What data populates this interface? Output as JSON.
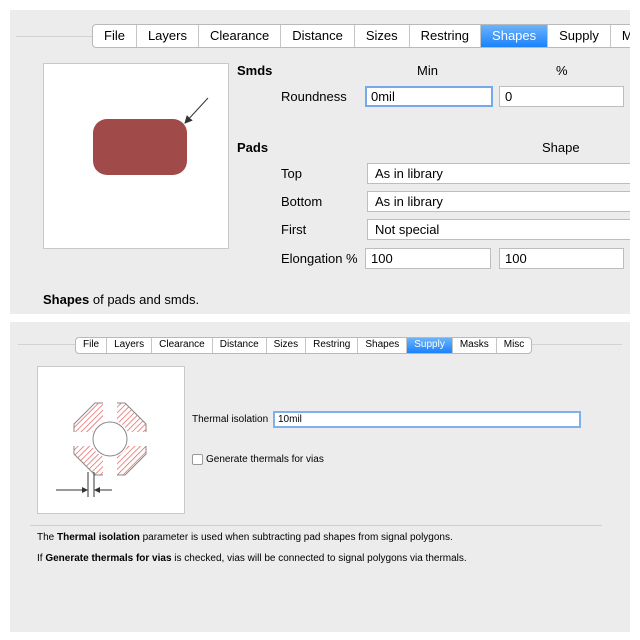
{
  "shapes_dialog": {
    "tabs": [
      {
        "label": "File",
        "active": false
      },
      {
        "label": "Layers",
        "active": false
      },
      {
        "label": "Clearance",
        "active": false
      },
      {
        "label": "Distance",
        "active": false
      },
      {
        "label": "Sizes",
        "active": false
      },
      {
        "label": "Restring",
        "active": false
      },
      {
        "label": "Shapes",
        "active": true
      },
      {
        "label": "Supply",
        "active": false
      },
      {
        "label": "Mas",
        "active": false
      }
    ],
    "smds_heading": "Smds",
    "min_col": "Min",
    "percent_col": "%",
    "roundness_label": "Roundness",
    "roundness_min": "0mil",
    "roundness_percent": "0",
    "pads_heading": "Pads",
    "shape_col": "Shape",
    "top_label": "Top",
    "top_value": "As in library",
    "bottom_label": "Bottom",
    "bottom_value": "As in library",
    "first_label": "First",
    "first_value": "Not special",
    "elongation_label": "Elongation %",
    "elongation_1": "100",
    "elongation_2": "100",
    "description_bold": "Shapes",
    "description_rest": " of pads and smds.",
    "pad_color": "#a04a4a"
  },
  "supply_dialog": {
    "tabs": [
      {
        "label": "File",
        "active": false
      },
      {
        "label": "Layers",
        "active": false
      },
      {
        "label": "Clearance",
        "active": false
      },
      {
        "label": "Distance",
        "active": false
      },
      {
        "label": "Sizes",
        "active": false
      },
      {
        "label": "Restring",
        "active": false
      },
      {
        "label": "Shapes",
        "active": false
      },
      {
        "label": "Supply",
        "active": true
      },
      {
        "label": "Masks",
        "active": false
      },
      {
        "label": "Misc",
        "active": false
      }
    ],
    "thermal_label": "Thermal isolation",
    "thermal_value": "10mil",
    "generate_label": "Generate thermals for vias",
    "generate_checked": false,
    "desc1_prefix": "The ",
    "desc1_bold": "Thermal isolation",
    "desc1_rest": " parameter is used when subtracting pad shapes from signal polygons.",
    "desc2_prefix": "If ",
    "desc2_bold": "Generate thermals for vias",
    "desc2_rest": " is checked, vias will be connected to signal polygons via thermals.",
    "hatch_color": "#e05050"
  },
  "accent_color": "#1a82fb"
}
